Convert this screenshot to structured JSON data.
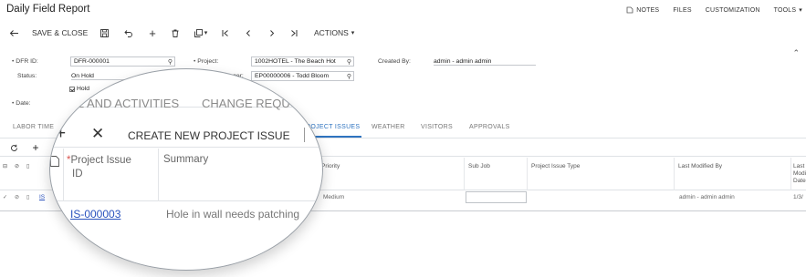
{
  "window": {
    "title": "Daily Field Report"
  },
  "topnav": {
    "notes": "NOTES",
    "files": "FILES",
    "customization": "CUSTOMIZATION",
    "tools": "TOOLS"
  },
  "toolbar": {
    "save_close": "SAVE & CLOSE",
    "actions": "ACTIONS"
  },
  "form": {
    "dfr_id_label": "DFR ID:",
    "dfr_id_value": "DFR-000001",
    "status_label": "Status:",
    "status_value": "On Hold",
    "hold_label": "Hold",
    "date_label": "Date:",
    "project_label": "Project:",
    "project_value": "1002HOTEL - The Beach Hot",
    "pm_label": "Project Manager:",
    "pm_value": "EP00000006 - Todd Bloom",
    "created_by_label": "Created By:",
    "created_by_value": "admin - admin admin"
  },
  "tabs": {
    "labor_time": "LABOR TIME",
    "project_issues": "PROJECT ISSUES",
    "weather": "WEATHER",
    "visitors": "VISITORS",
    "approvals": "APPROVALS"
  },
  "grid": {
    "columns": {
      "priority": "Priority",
      "sub_job": "Sub Job",
      "issue_type": "Project Issue Type",
      "last_modified_by": "Last Modified By",
      "last_modified_date_1": "Last",
      "last_modified_date_2": "Modi",
      "last_modified_date_3": "Date"
    },
    "row": {
      "id_fragment": "IS",
      "priority": "Medium",
      "last_modified_by": "admin - admin admin",
      "date_fragment": "1/3/"
    }
  },
  "lens": {
    "tab_left": "IME AND ACTIVITIES",
    "tab_right": "CHANGE REQU",
    "create_label": "CREATE NEW PROJECT ISSUE",
    "col_issue_id_1": "Project Issue",
    "col_issue_id_2": "ID",
    "col_summary": "Summary",
    "row_issue_id": "IS-000003",
    "row_summary": "Hole in wall needs patching"
  },
  "colors": {
    "accent": "#2f74c0",
    "link": "#2a52be",
    "required": "#d9534f"
  }
}
